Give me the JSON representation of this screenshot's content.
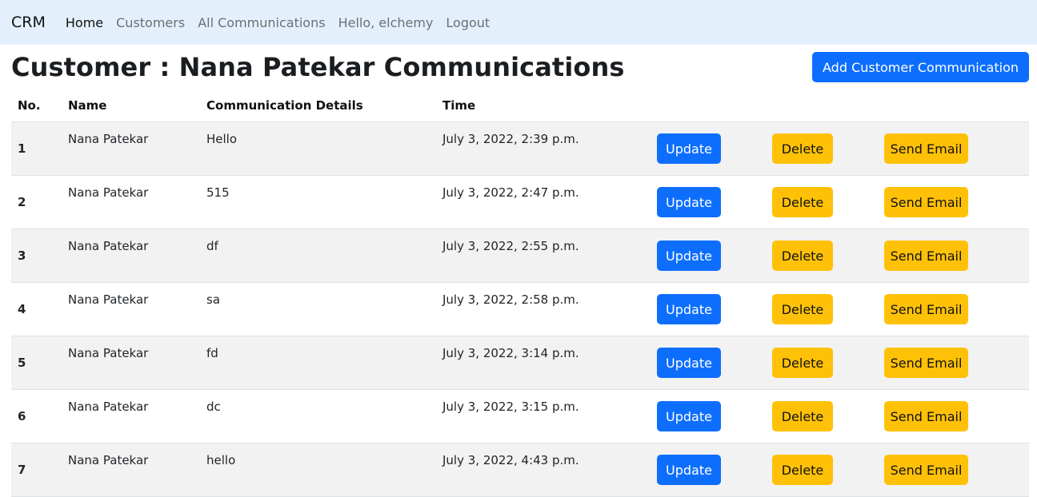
{
  "navbar": {
    "brand": "CRM",
    "links": [
      "Home",
      "Customers",
      "All Communications",
      "Hello, elchemy",
      "Logout"
    ]
  },
  "page": {
    "title": "Customer : Nana Patekar Communications",
    "add_button": "Add Customer Communication"
  },
  "table": {
    "headers": [
      "No.",
      "Name",
      "Communication Details",
      "Time"
    ],
    "rows": [
      {
        "no": "1",
        "name": "Nana Patekar",
        "details": "Hello",
        "time": "July 3, 2022, 2:39 p.m."
      },
      {
        "no": "2",
        "name": "Nana Patekar",
        "details": "515",
        "time": "July 3, 2022, 2:47 p.m."
      },
      {
        "no": "3",
        "name": "Nana Patekar",
        "details": "df",
        "time": "July 3, 2022, 2:55 p.m."
      },
      {
        "no": "4",
        "name": "Nana Patekar",
        "details": "sa",
        "time": "July 3, 2022, 2:58 p.m."
      },
      {
        "no": "5",
        "name": "Nana Patekar",
        "details": "fd",
        "time": "July 3, 2022, 3:14 p.m."
      },
      {
        "no": "6",
        "name": "Nana Patekar",
        "details": "dc",
        "time": "July 3, 2022, 3:15 p.m."
      },
      {
        "no": "7",
        "name": "Nana Patekar",
        "details": "hello",
        "time": "July 3, 2022, 4:43 p.m."
      }
    ],
    "actions": {
      "update": "Update",
      "delete": "Delete",
      "send_email": "Send Email"
    }
  },
  "colors": {
    "primary": "#0d6efd",
    "warning": "#ffc107",
    "navbar": "#e3f0fb",
    "stripe": "#f2f2f2"
  }
}
